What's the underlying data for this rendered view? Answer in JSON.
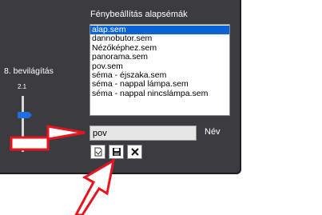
{
  "panel": {
    "title": "Fénybeállítás alapsémák",
    "presets": [
      "alap.sem",
      "dannobutor.sem",
      "Nézőképhez.sem",
      "panorama.sem",
      "pov.sem",
      "séma - éjszaka.sem",
      "séma - nappal lámpa.sem",
      "séma - nappal nincslámpa.sem"
    ],
    "selected_index": 0,
    "lighting_label": "8. bevilágítás",
    "slider_value": "2.1",
    "name_value": "pov",
    "name_label": "Név"
  },
  "toolbar": {
    "icons": [
      "open-file-icon",
      "save-icon",
      "delete-icon"
    ]
  },
  "colors": {
    "panel_bg": "#3c3c40",
    "selection": "#0a64d6",
    "slider_thumb": "#1e6fe0",
    "annotation_arrow": "#e8141e"
  }
}
